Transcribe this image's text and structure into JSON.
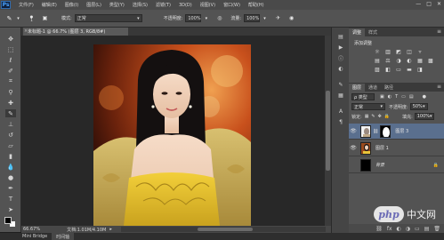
{
  "app": {
    "logo": "Ps"
  },
  "menu": [
    "文件(F)",
    "编辑(E)",
    "图像(I)",
    "图层(L)",
    "类型(Y)",
    "选择(S)",
    "滤镜(T)",
    "3D(D)",
    "视图(V)",
    "窗口(W)",
    "帮助(H)"
  ],
  "window_controls": [
    "—",
    "□",
    "✕"
  ],
  "options": {
    "size_value": "1",
    "mode_label": "模式:",
    "mode_value": "正常",
    "opacity_label": "不透明度:",
    "opacity_value": "100%",
    "flow_label": "流量:",
    "flow_value": "100%"
  },
  "document": {
    "tab_title": "未标题-1 @ 66.7% (图层 3, RGB/8#)",
    "close_glyph": "×"
  },
  "status": {
    "zoom": "66.67%",
    "doc_info": "文档:1.01M/4.10M"
  },
  "bottom_tabs": [
    "Mini Bridge",
    "时间轴"
  ],
  "adjustments": {
    "tabs": [
      "调整",
      "样式"
    ],
    "title": "添加调整",
    "row1": [
      "☼",
      "▥",
      "◩",
      "◫",
      "▿"
    ],
    "row2": [
      "▤",
      "⚖",
      "◑",
      "◐",
      "▦",
      "▩"
    ],
    "row3": [
      "▨",
      "◧",
      "▭",
      "▬",
      "◨"
    ]
  },
  "layers_panel": {
    "tabs": [
      "图层",
      "通道",
      "路径"
    ],
    "kind_label": "ρ 类型",
    "blend_mode": "正常",
    "opacity_label": "不透明度:",
    "opacity_value": "50%",
    "lock_label": "锁定:",
    "fill_label": "填充:",
    "fill_value": "100%",
    "layers": [
      {
        "name": "图层 3",
        "selected": true
      },
      {
        "name": "图层 1",
        "selected": false
      },
      {
        "name": "背景",
        "selected": false
      }
    ],
    "footer_icons": [
      "⛓",
      "fx",
      "◐",
      "◑",
      "▭",
      "▤",
      "🗑"
    ]
  },
  "watermark": {
    "badge": "php",
    "text": "中文网"
  },
  "colors": {
    "panel": "#535353",
    "canvas": "#282828",
    "selected_layer": "#5a6f8e"
  }
}
